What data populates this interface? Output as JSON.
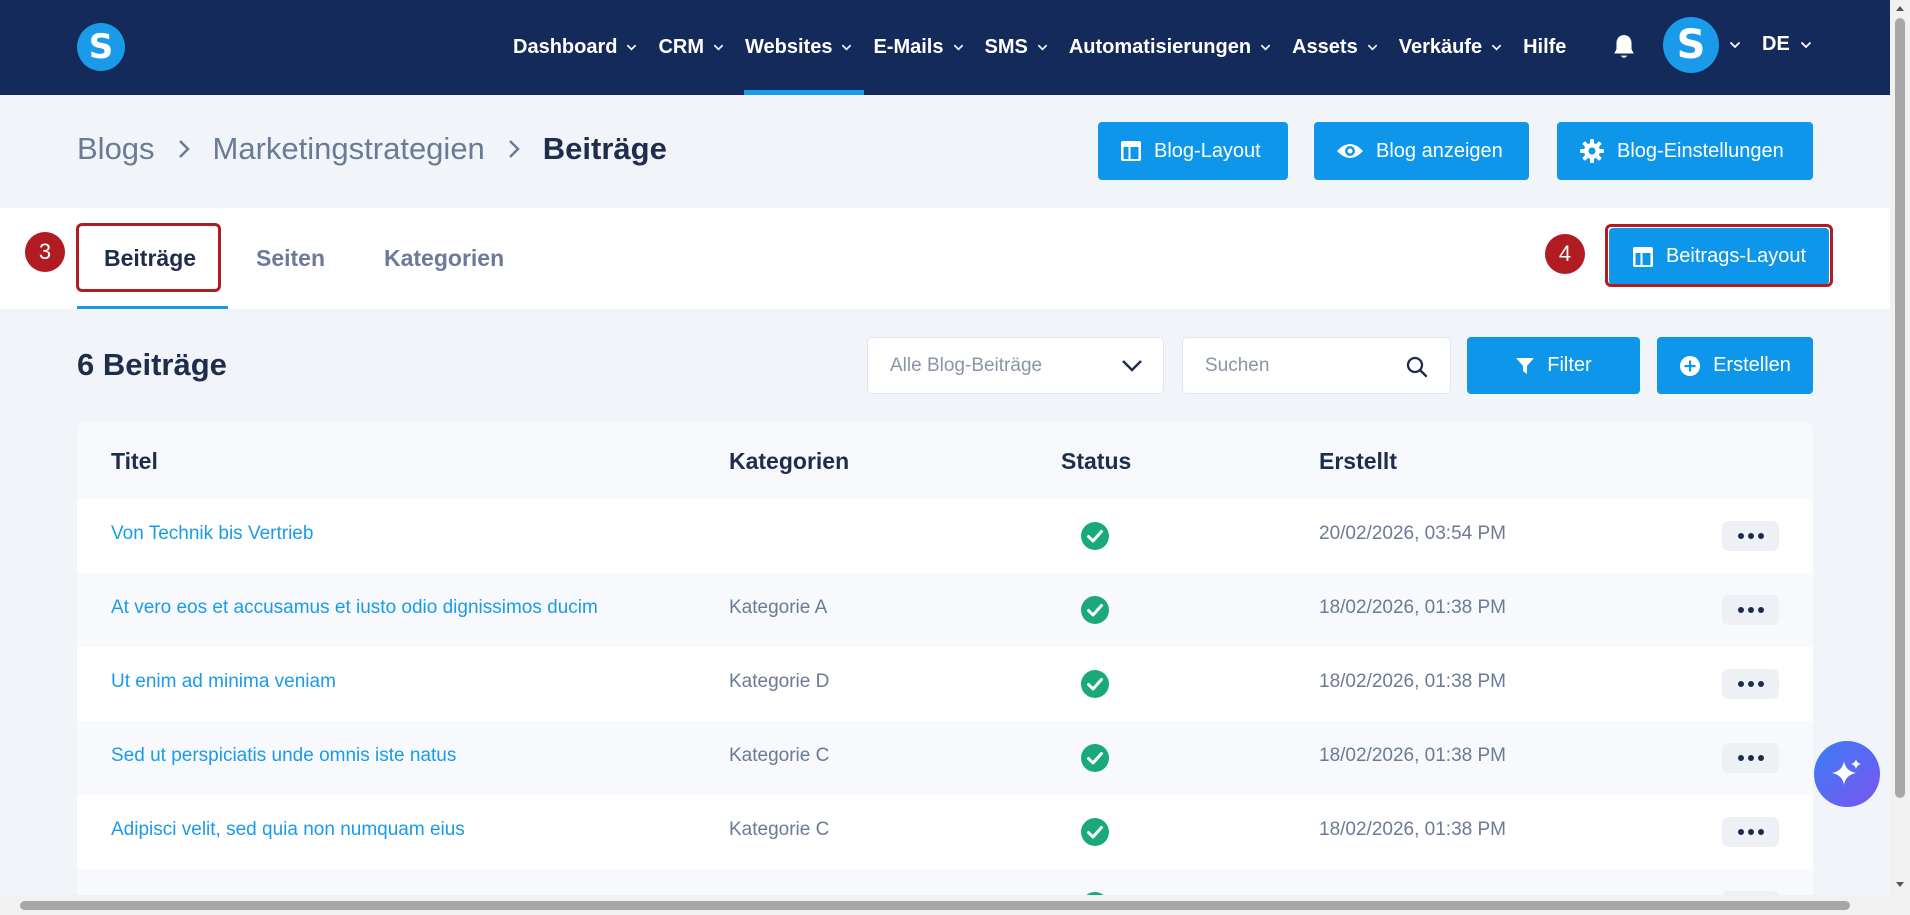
{
  "nav": {
    "logo_letter": "S",
    "items": [
      {
        "label": "Dashboard",
        "has_dropdown": true,
        "active": false
      },
      {
        "label": "CRM",
        "has_dropdown": true,
        "active": false
      },
      {
        "label": "Websites",
        "has_dropdown": true,
        "active": true
      },
      {
        "label": "E-Mails",
        "has_dropdown": true,
        "active": false
      },
      {
        "label": "SMS",
        "has_dropdown": true,
        "active": false
      },
      {
        "label": "Automatisierungen",
        "has_dropdown": true,
        "active": false
      },
      {
        "label": "Assets",
        "has_dropdown": true,
        "active": false
      },
      {
        "label": "Verkäufe",
        "has_dropdown": true,
        "active": false
      },
      {
        "label": "Hilfe",
        "has_dropdown": false,
        "active": false
      }
    ],
    "avatar_letter": "S",
    "language": "DE"
  },
  "breadcrumb": {
    "items": [
      "Blogs",
      "Marketingstrategien"
    ],
    "current": "Beiträge"
  },
  "header_buttons": {
    "blog_layout": "Blog-Layout",
    "blog_view": "Blog anzeigen",
    "blog_settings": "Blog-Einstellungen"
  },
  "tabs": [
    {
      "label": "Beiträge",
      "active": true
    },
    {
      "label": "Seiten",
      "active": false
    },
    {
      "label": "Kategorien",
      "active": false
    }
  ],
  "annotations": {
    "tab_badge": "3",
    "layout_badge": "4",
    "highlight_color": "#b01c22"
  },
  "post_layout_button": "Beitrags-Layout",
  "list": {
    "count_title": "6 Beiträge",
    "filter_select": "Alle Blog-Beiträge",
    "search_placeholder": "Suchen",
    "filter_button": "Filter",
    "create_button": "Erstellen"
  },
  "table": {
    "columns": [
      "Titel",
      "Kategorien",
      "Status",
      "Erstellt"
    ],
    "rows": [
      {
        "title": "Von Technik bis Vertrieb",
        "category": "",
        "status": "published",
        "created": "20/02/2026, 03:54 PM"
      },
      {
        "title": "At vero eos et accusamus et iusto odio dignissimos ducim",
        "category": "Kategorie A",
        "status": "published",
        "created": "18/02/2026, 01:38 PM"
      },
      {
        "title": "Ut enim ad minima veniam",
        "category": "Kategorie D",
        "status": "published",
        "created": "18/02/2026, 01:38 PM"
      },
      {
        "title": "Sed ut perspiciatis unde omnis iste natus",
        "category": "Kategorie C",
        "status": "published",
        "created": "18/02/2026, 01:38 PM"
      },
      {
        "title": "Adipisci velit, sed quia non numquam eius",
        "category": "Kategorie C",
        "status": "published",
        "created": "18/02/2026, 01:38 PM"
      },
      {
        "title": "",
        "category": "",
        "status": "published",
        "created": ""
      }
    ]
  },
  "colors": {
    "nav_bg": "#142a5a",
    "accent": "#1a9be9",
    "button": "#0e96ea",
    "status_green": "#1aa97a"
  }
}
